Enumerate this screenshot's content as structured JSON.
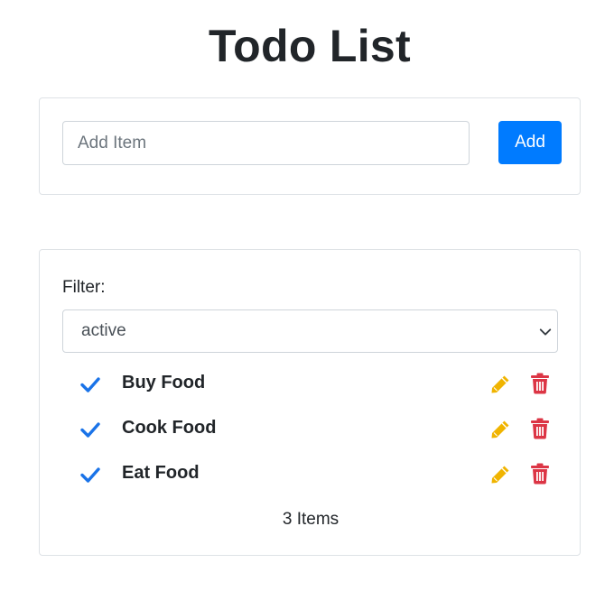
{
  "title": "Todo List",
  "add_form": {
    "input_value": "",
    "input_placeholder": "Add Item",
    "button_label": "Add"
  },
  "filter": {
    "label": "Filter:",
    "selected": "active"
  },
  "items": [
    {
      "text": "Buy Food",
      "completed_icon": "check-icon",
      "edit_icon": "pencil-icon",
      "delete_icon": "trash-icon"
    },
    {
      "text": "Cook Food",
      "completed_icon": "check-icon",
      "edit_icon": "pencil-icon",
      "delete_icon": "trash-icon"
    },
    {
      "text": "Eat Food",
      "completed_icon": "check-icon",
      "edit_icon": "pencil-icon",
      "delete_icon": "trash-icon"
    }
  ],
  "count_text": "3 Items",
  "colors": {
    "primary": "#007bff",
    "check": "#1a73e8",
    "edit": "#f0b400",
    "delete": "#dc3545"
  }
}
